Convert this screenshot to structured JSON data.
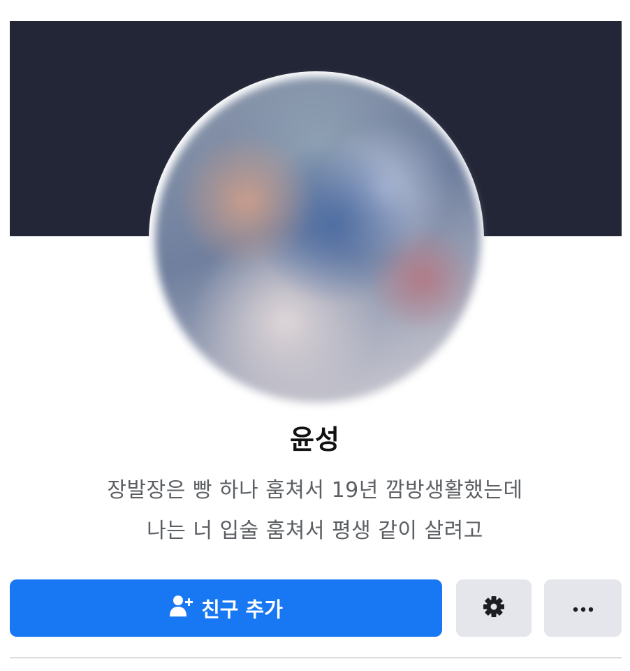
{
  "profile": {
    "name": "윤성",
    "bio_line1": "장발장은 빵 하나 훔쳐서 19년 깜방생활했는데",
    "bio_line2": "나는 너 입술 훔쳐서 평생 같이 살려고"
  },
  "actions": {
    "add_friend_label": "친구 추가",
    "add_friend_icon": "add-friend-icon",
    "settings_icon": "gear-icon",
    "more_icon": "more-dots-icon"
  },
  "colors": {
    "cover": "#232636",
    "primary_button": "#1877f2",
    "secondary_button": "#e4e6eb"
  }
}
